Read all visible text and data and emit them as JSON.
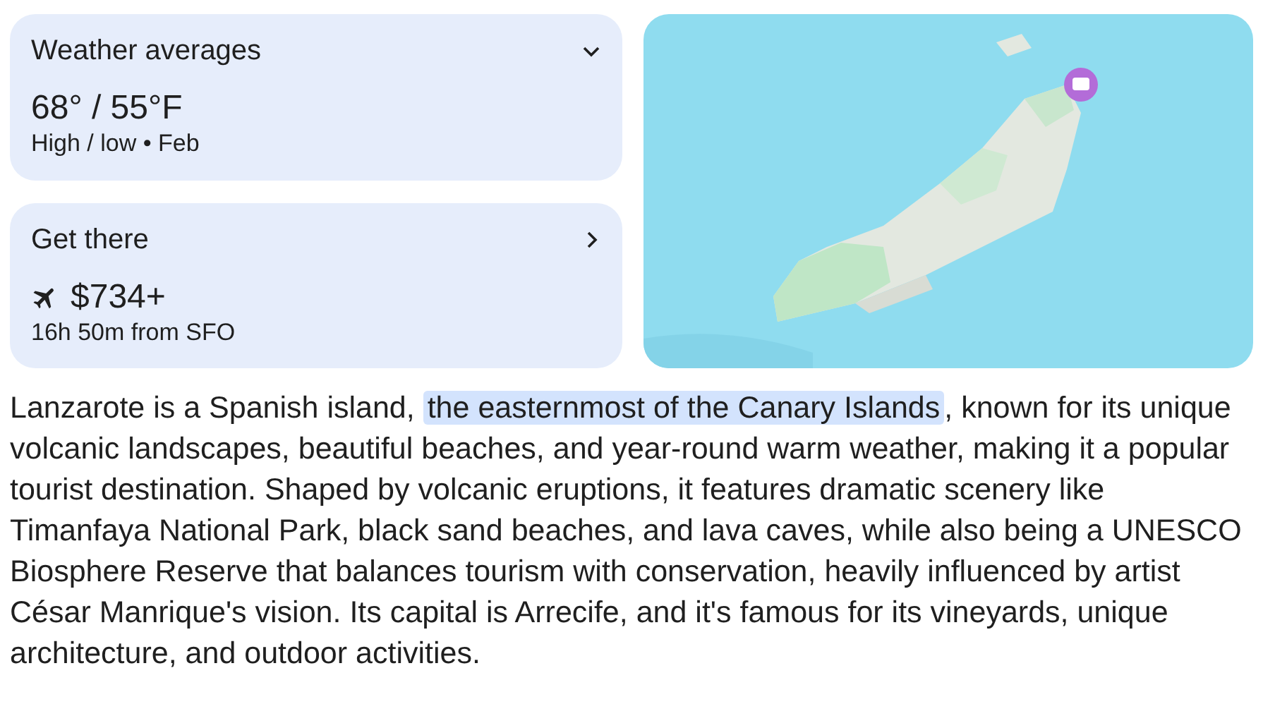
{
  "weather": {
    "title": "Weather averages",
    "expanded": false,
    "temps": "68° / 55°F",
    "subtitle": "High / low • Feb"
  },
  "travel": {
    "title": "Get there",
    "price": "$734+",
    "subtitle": "16h 50m from SFO"
  },
  "summary": {
    "before": "Lanzarote is a Spanish island, ",
    "highlight": "the easternmost of the Canary Islands",
    "after": ", known for its unique volcanic landscapes, beautiful beaches, and year-round warm weather, making it a popular tourist destination. Shaped by volcanic eruptions, it features dramatic scenery like Timanfaya National Park, black sand beaches, and lava caves, while also being a UNESCO Biosphere Reserve that balances tourism with conservation, heavily influenced by artist César Manrique's vision. Its capital is Arrecife, and it's famous for its vineyards, unique architecture, and outdoor activities."
  }
}
